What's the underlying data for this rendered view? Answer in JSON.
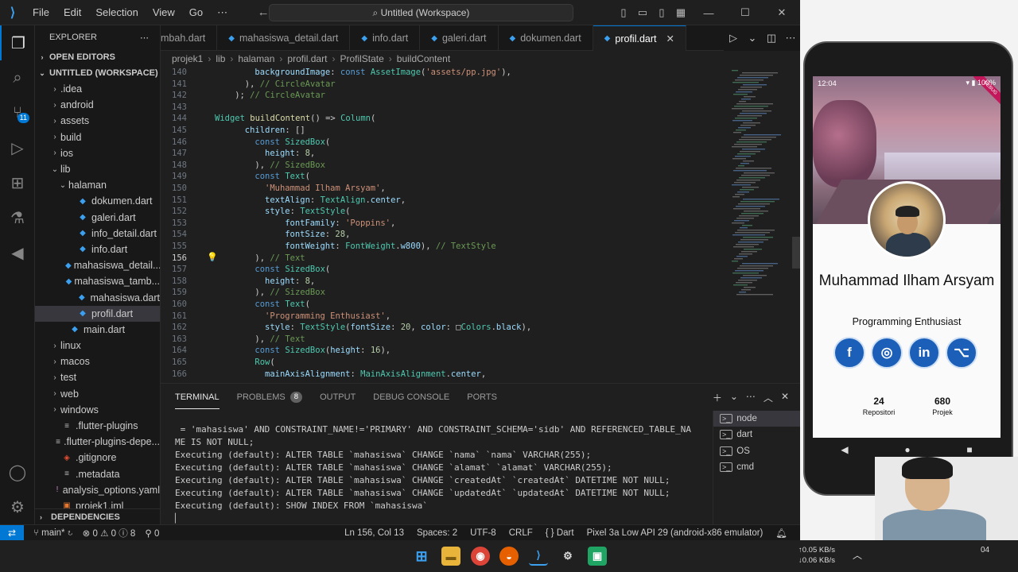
{
  "titlebar": {
    "menu": [
      "File",
      "Edit",
      "Selection",
      "View",
      "Go",
      "⋯"
    ],
    "search": "Untitled (Workspace)"
  },
  "explorer": {
    "title": "EXPLORER",
    "open_editors": "OPEN EDITORS",
    "workspace": "UNTITLED (WORKSPACE)",
    "tree": [
      {
        "label": ".idea",
        "type": "folder",
        "depth": 1
      },
      {
        "label": "android",
        "type": "folder",
        "depth": 1
      },
      {
        "label": "assets",
        "type": "folder",
        "depth": 1
      },
      {
        "label": "build",
        "type": "folder",
        "depth": 1
      },
      {
        "label": "ios",
        "type": "folder",
        "depth": 1
      },
      {
        "label": "lib",
        "type": "folder-open",
        "depth": 1
      },
      {
        "label": "halaman",
        "type": "folder-open",
        "depth": 2
      },
      {
        "label": "dokumen.dart",
        "type": "dart",
        "depth": 3
      },
      {
        "label": "galeri.dart",
        "type": "dart",
        "depth": 3
      },
      {
        "label": "info_detail.dart",
        "type": "dart",
        "depth": 3
      },
      {
        "label": "info.dart",
        "type": "dart",
        "depth": 3
      },
      {
        "label": "mahasiswa_detail...",
        "type": "dart",
        "depth": 3
      },
      {
        "label": "mahasiswa_tamb...",
        "type": "dart",
        "depth": 3
      },
      {
        "label": "mahasiswa.dart",
        "type": "dart",
        "depth": 3
      },
      {
        "label": "profil.dart",
        "type": "dart",
        "depth": 3,
        "selected": true
      },
      {
        "label": "main.dart",
        "type": "dart",
        "depth": 2
      },
      {
        "label": "linux",
        "type": "folder",
        "depth": 1
      },
      {
        "label": "macos",
        "type": "folder",
        "depth": 1
      },
      {
        "label": "test",
        "type": "folder",
        "depth": 1
      },
      {
        "label": "web",
        "type": "folder",
        "depth": 1
      },
      {
        "label": "windows",
        "type": "folder",
        "depth": 1
      },
      {
        "label": ".flutter-plugins",
        "type": "file",
        "depth": 1
      },
      {
        "label": ".flutter-plugins-depe...",
        "type": "file",
        "depth": 1
      },
      {
        "label": ".gitignore",
        "type": "git",
        "depth": 1
      },
      {
        "label": ".metadata",
        "type": "file",
        "depth": 1
      },
      {
        "label": "analysis_options.yaml",
        "type": "yaml",
        "depth": 1
      },
      {
        "label": "projek1.iml",
        "type": "iml",
        "depth": 1
      }
    ],
    "dependencies": "DEPENDENCIES"
  },
  "tabs": [
    {
      "label": "mbah.dart"
    },
    {
      "label": "mahasiswa_detail.dart"
    },
    {
      "label": "info.dart"
    },
    {
      "label": "galeri.dart"
    },
    {
      "label": "dokumen.dart"
    },
    {
      "label": "profil.dart",
      "active": true
    }
  ],
  "breadcrumb": [
    "projek1",
    "lib",
    "halaman",
    "profil.dart",
    "ProfilState",
    "buildContent"
  ],
  "editor": {
    "current_line": 156,
    "lines": [
      {
        "n": 140,
        "indent": 8,
        "tokens": [
          [
            "p",
            "backgroundImage"
          ],
          [
            "w",
            ": "
          ],
          [
            "k",
            "const "
          ],
          [
            "t",
            "AssetImage"
          ],
          [
            "w",
            "("
          ],
          [
            "s",
            "'assets/pp.jpg'"
          ],
          [
            "w",
            "),"
          ]
        ]
      },
      {
        "n": 141,
        "indent": 6,
        "tokens": [
          [
            "w",
            "), "
          ],
          [
            "c",
            "// CircleAvatar"
          ]
        ]
      },
      {
        "n": 142,
        "indent": 4,
        "tokens": [
          [
            "w",
            "); "
          ],
          [
            "c",
            "// CircleAvatar"
          ]
        ]
      },
      {
        "n": 143,
        "indent": 0,
        "tokens": []
      },
      {
        "n": 144,
        "indent": 0,
        "tokens": [
          [
            "t",
            "Widget "
          ],
          [
            "f",
            "buildContent"
          ],
          [
            "w",
            "() => "
          ],
          [
            "t",
            "Column"
          ],
          [
            "w",
            "("
          ]
        ]
      },
      {
        "n": 145,
        "indent": 6,
        "tokens": [
          [
            "p",
            "children"
          ],
          [
            "w",
            ": []"
          ]
        ]
      },
      {
        "n": 146,
        "indent": 8,
        "tokens": [
          [
            "k",
            "const "
          ],
          [
            "t",
            "SizedBox"
          ],
          [
            "w",
            "("
          ]
        ]
      },
      {
        "n": 147,
        "indent": 10,
        "tokens": [
          [
            "p",
            "height"
          ],
          [
            "w",
            ": "
          ],
          [
            "n",
            "8"
          ],
          [
            "w",
            ","
          ]
        ]
      },
      {
        "n": 148,
        "indent": 8,
        "tokens": [
          [
            "w",
            "), "
          ],
          [
            "c",
            "// SizedBox"
          ]
        ]
      },
      {
        "n": 149,
        "indent": 8,
        "tokens": [
          [
            "k",
            "const "
          ],
          [
            "t",
            "Text"
          ],
          [
            "w",
            "("
          ]
        ]
      },
      {
        "n": 150,
        "indent": 10,
        "tokens": [
          [
            "s",
            "'Muhammad Ilham Arsyam'"
          ],
          [
            "w",
            ","
          ]
        ]
      },
      {
        "n": 151,
        "indent": 10,
        "tokens": [
          [
            "p",
            "textAlign"
          ],
          [
            "w",
            ": "
          ],
          [
            "t",
            "TextAlign"
          ],
          [
            "w",
            "."
          ],
          [
            "p",
            "center"
          ],
          [
            "w",
            ","
          ]
        ]
      },
      {
        "n": 152,
        "indent": 10,
        "tokens": [
          [
            "p",
            "style"
          ],
          [
            "w",
            ": "
          ],
          [
            "t",
            "TextStyle"
          ],
          [
            "w",
            "("
          ]
        ]
      },
      {
        "n": 153,
        "indent": 14,
        "tokens": [
          [
            "p",
            "fontFamily"
          ],
          [
            "w",
            ": "
          ],
          [
            "s",
            "'Poppins'"
          ],
          [
            "w",
            ","
          ]
        ]
      },
      {
        "n": 154,
        "indent": 14,
        "tokens": [
          [
            "p",
            "fontSize"
          ],
          [
            "w",
            ": "
          ],
          [
            "n",
            "28"
          ],
          [
            "w",
            ","
          ]
        ]
      },
      {
        "n": 155,
        "indent": 14,
        "tokens": [
          [
            "p",
            "fontWeight"
          ],
          [
            "w",
            ": "
          ],
          [
            "t",
            "FontWeight"
          ],
          [
            "w",
            "."
          ],
          [
            "p",
            "w800"
          ],
          [
            "w",
            "), "
          ],
          [
            "c",
            "// TextStyle"
          ]
        ]
      },
      {
        "n": 156,
        "indent": 8,
        "tokens": [
          [
            "w",
            "), "
          ],
          [
            "c",
            "// Text"
          ]
        ]
      },
      {
        "n": 157,
        "indent": 8,
        "tokens": [
          [
            "k",
            "const "
          ],
          [
            "t",
            "SizedBox"
          ],
          [
            "w",
            "("
          ]
        ]
      },
      {
        "n": 158,
        "indent": 10,
        "tokens": [
          [
            "p",
            "height"
          ],
          [
            "w",
            ": "
          ],
          [
            "n",
            "8"
          ],
          [
            "w",
            ","
          ]
        ]
      },
      {
        "n": 159,
        "indent": 8,
        "tokens": [
          [
            "w",
            "), "
          ],
          [
            "c",
            "// SizedBox"
          ]
        ]
      },
      {
        "n": 160,
        "indent": 8,
        "tokens": [
          [
            "k",
            "const "
          ],
          [
            "t",
            "Text"
          ],
          [
            "w",
            "("
          ]
        ]
      },
      {
        "n": 161,
        "indent": 10,
        "tokens": [
          [
            "s",
            "'Programming Enthusiast'"
          ],
          [
            "w",
            ","
          ]
        ]
      },
      {
        "n": 162,
        "indent": 10,
        "tokens": [
          [
            "p",
            "style"
          ],
          [
            "w",
            ": "
          ],
          [
            "t",
            "TextStyle"
          ],
          [
            "w",
            "("
          ],
          [
            "p",
            "fontSize"
          ],
          [
            "w",
            ": "
          ],
          [
            "n",
            "20"
          ],
          [
            "w",
            ", "
          ],
          [
            "p",
            "color"
          ],
          [
            "w",
            ": □"
          ],
          [
            "t",
            "Colors"
          ],
          [
            "w",
            "."
          ],
          [
            "p",
            "black"
          ],
          [
            "w",
            "),"
          ]
        ]
      },
      {
        "n": 163,
        "indent": 8,
        "tokens": [
          [
            "w",
            "), "
          ],
          [
            "c",
            "// Text"
          ]
        ]
      },
      {
        "n": 164,
        "indent": 8,
        "tokens": [
          [
            "k",
            "const "
          ],
          [
            "t",
            "SizedBox"
          ],
          [
            "w",
            "("
          ],
          [
            "p",
            "height"
          ],
          [
            "w",
            ": "
          ],
          [
            "n",
            "16"
          ],
          [
            "w",
            "),"
          ]
        ]
      },
      {
        "n": 165,
        "indent": 8,
        "tokens": [
          [
            "t",
            "Row"
          ],
          [
            "w",
            "("
          ]
        ]
      },
      {
        "n": 166,
        "indent": 10,
        "tokens": [
          [
            "p",
            "mainAxisAlignment"
          ],
          [
            "w",
            ": "
          ],
          [
            "t",
            "MainAxisAlignment"
          ],
          [
            "w",
            "."
          ],
          [
            "p",
            "center"
          ],
          [
            "w",
            ","
          ]
        ]
      }
    ]
  },
  "panel": {
    "tabs": [
      "TERMINAL",
      "PROBLEMS",
      "OUTPUT",
      "DEBUG CONSOLE",
      "PORTS"
    ],
    "problems_count": "8",
    "terminal_lines": [
      " = 'mahasiswa' AND CONSTRAINT_NAME!='PRIMARY' AND CONSTRAINT_SCHEMA='sidb' AND REFERENCED_TABLE_NA",
      "ME IS NOT NULL;",
      "Executing (default): ALTER TABLE `mahasiswa` CHANGE `nama` `nama` VARCHAR(255);",
      "Executing (default): ALTER TABLE `mahasiswa` CHANGE `alamat` `alamat` VARCHAR(255);",
      "Executing (default): ALTER TABLE `mahasiswa` CHANGE `createdAt` `createdAt` DATETIME NOT NULL;",
      "Executing (default): ALTER TABLE `mahasiswa` CHANGE `updatedAt` `updatedAt` DATETIME NOT NULL;",
      "Executing (default): SHOW INDEX FROM `mahasiswa`",
      "▏"
    ],
    "terminals": [
      "node",
      "dart",
      "OS",
      "cmd"
    ]
  },
  "statusbar": {
    "branch": "main*",
    "errors": "0",
    "warnings": "0",
    "infos": "8",
    "ports": "0",
    "position": "Ln 156, Col 13",
    "spaces": "Spaces: 2",
    "encoding": "UTF-8",
    "eol": "CRLF",
    "language": "Dart",
    "device": "Pixel 3a Low API 29 (android-x86 emulator)"
  },
  "phone": {
    "time": "12:04",
    "battery": "100%",
    "debug_banner": "DEBUG",
    "name": "Muhammad Ilham Arsyam",
    "tagline": "Programming Enthusiast",
    "socials": [
      "facebook-icon",
      "instagram-icon",
      "linkedin-icon",
      "github-icon"
    ],
    "stats": [
      {
        "value": "24",
        "label": "Repositori"
      },
      {
        "value": "680",
        "label": "Projek"
      }
    ]
  },
  "taskbar": {
    "net_up": "0.05 KB/s",
    "net_down": "0.06 KB/s",
    "time_fragment": "04"
  },
  "colors": {
    "accent": "#0078d4",
    "social_blue": "#1b5fb8"
  }
}
